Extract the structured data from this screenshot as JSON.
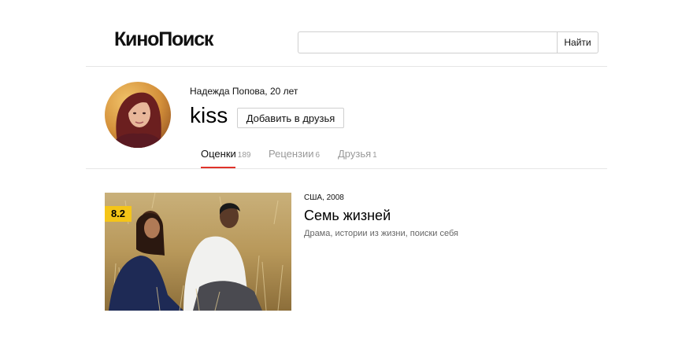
{
  "header": {
    "logo_text": "КиноПоиск",
    "search": {
      "value": "",
      "placeholder": ""
    },
    "search_button_label": "Найти"
  },
  "profile": {
    "caption": "Надежда Попова, 20 лет",
    "nickname": "kiss",
    "add_friend_label": "Добавить в друзья"
  },
  "tabs": [
    {
      "label": "Оценки",
      "count": "189",
      "active": true
    },
    {
      "label": "Рецензии",
      "count": "6",
      "active": false
    },
    {
      "label": "Друзья",
      "count": "1",
      "active": false
    }
  ],
  "colors": {
    "accent": "#e0322a",
    "rating_badge": "#f5c518"
  },
  "movie": {
    "rating": "8.2",
    "meta": "США, 2008",
    "title": "Семь жизней",
    "genres": "Драма, истории из жизни, поиски себя"
  }
}
